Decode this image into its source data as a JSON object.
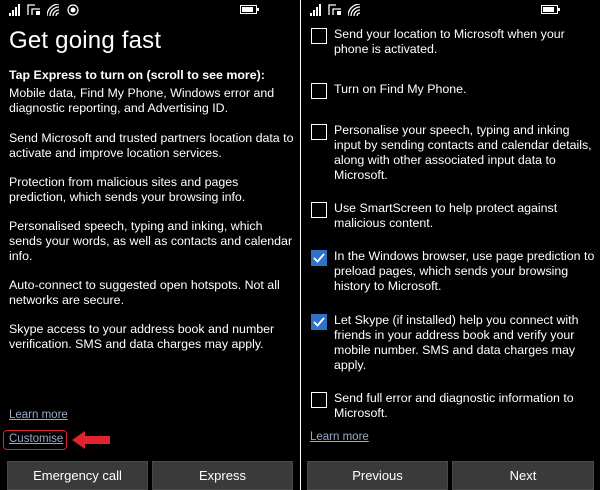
{
  "left_screen": {
    "title": "Get going fast",
    "intro": "Tap Express to turn on (scroll to see more):",
    "paragraphs": [
      "Mobile data, Find My Phone, Windows error and diagnostic reporting, and Advertising ID.",
      "Send Microsoft and trusted partners location data to activate and improve location services.",
      "Protection from malicious sites and pages prediction, which sends your browsing info.",
      "Personalised speech, typing and inking, which sends your words, as well as contacts and calendar info.",
      "Auto-connect to suggested open hotspots. Not all networks are secure.",
      "Skype access to your address book and number verification. SMS and data charges may apply."
    ],
    "learn_more": "Learn more",
    "customise": "Customise",
    "emergency_call": "Emergency call",
    "express": "Express"
  },
  "right_screen": {
    "options": [
      {
        "label": "Send your location to Microsoft when your phone is activated.",
        "checked": false
      },
      {
        "label": "Turn on Find My Phone.",
        "checked": false
      },
      {
        "label": "Personalise your speech, typing and inking input by sending contacts and calendar details, along with other associated input data to Microsoft.",
        "checked": false
      },
      {
        "label": "Use SmartScreen to help protect against malicious content.",
        "checked": false
      },
      {
        "label": "In the Windows browser, use page prediction to preload pages, which sends your browsing history to Microsoft.",
        "checked": true
      },
      {
        "label": "Let Skype (if installed) help you connect with friends in your address book and verify your mobile number. SMS and data charges may apply.",
        "checked": true
      },
      {
        "label": "Send full error and diagnostic information to Microsoft.",
        "checked": false
      }
    ],
    "learn_more": "Learn more",
    "previous": "Previous",
    "next": "Next"
  },
  "colors": {
    "background": "#000000",
    "accent": "#2d74c9",
    "link": "#9aa9c9",
    "highlight": "#e0232c",
    "button": "#3a3a3a"
  }
}
